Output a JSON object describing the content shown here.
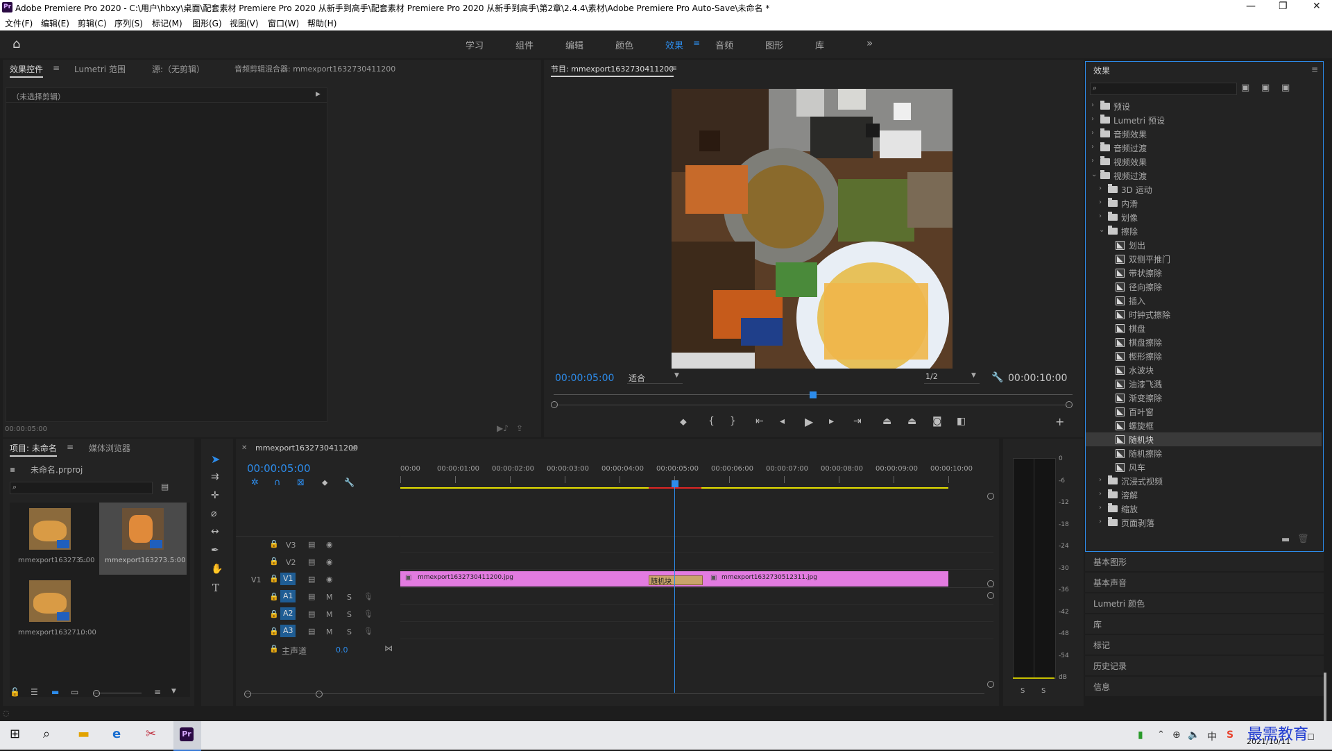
{
  "window": {
    "app_icon": "Pr",
    "title": "Adobe Premiere Pro 2020 - C:\\用户\\hbxy\\桌面\\配套素材 Premiere Pro 2020 从新手到高手\\配套素材 Premiere Pro 2020 从新手到高手\\第2章\\2.4.4\\素材\\Adobe Premiere Pro Auto-Save\\未命名 *"
  },
  "menu": [
    "文件(F)",
    "编辑(E)",
    "剪辑(C)",
    "序列(S)",
    "标记(M)",
    "图形(G)",
    "视图(V)",
    "窗口(W)",
    "帮助(H)"
  ],
  "workspaces": [
    "学习",
    "组件",
    "编辑",
    "颜色",
    "效果",
    "音频",
    "图形",
    "库"
  ],
  "active_workspace": "效果",
  "source_panel": {
    "tabs": [
      "效果控件",
      "Lumetri 范围",
      "源:（无剪辑）",
      "音频剪辑混合器: mmexport1632730411200"
    ],
    "no_clip": "（未选择剪辑）",
    "timecode": "00:00:05:00"
  },
  "program": {
    "tab": "节目: mmexport1632730411200",
    "timecode": "00:00:05:00",
    "fit": "适合",
    "resolution": "1/2",
    "duration": "00:00:10:00",
    "playhead_fraction": 0.5
  },
  "effects_panel": {
    "title": "效果",
    "tree": [
      {
        "label": "预设",
        "type": "preset",
        "depth": 0,
        "open": false
      },
      {
        "label": "Lumetri 预设",
        "type": "preset",
        "depth": 0,
        "open": false
      },
      {
        "label": "音频效果",
        "type": "folder",
        "depth": 0,
        "open": false
      },
      {
        "label": "音频过渡",
        "type": "folder",
        "depth": 0,
        "open": false
      },
      {
        "label": "视频效果",
        "type": "folder",
        "depth": 0,
        "open": false
      },
      {
        "label": "视频过渡",
        "type": "folder",
        "depth": 0,
        "open": true
      },
      {
        "label": "3D 运动",
        "type": "folder",
        "depth": 1,
        "open": false
      },
      {
        "label": "内滑",
        "type": "folder",
        "depth": 1,
        "open": false
      },
      {
        "label": "划像",
        "type": "folder",
        "depth": 1,
        "open": false
      },
      {
        "label": "擦除",
        "type": "folder",
        "depth": 1,
        "open": true
      },
      {
        "label": "划出",
        "type": "fx",
        "depth": 2
      },
      {
        "label": "双侧平推门",
        "type": "fx",
        "depth": 2
      },
      {
        "label": "带状擦除",
        "type": "fx",
        "depth": 2
      },
      {
        "label": "径向擦除",
        "type": "fx",
        "depth": 2
      },
      {
        "label": "插入",
        "type": "fx",
        "depth": 2
      },
      {
        "label": "时钟式擦除",
        "type": "fx",
        "depth": 2
      },
      {
        "label": "棋盘",
        "type": "fx",
        "depth": 2
      },
      {
        "label": "棋盘擦除",
        "type": "fx",
        "depth": 2
      },
      {
        "label": "楔形擦除",
        "type": "fx",
        "depth": 2
      },
      {
        "label": "水波块",
        "type": "fx",
        "depth": 2
      },
      {
        "label": "油漆飞溅",
        "type": "fx",
        "depth": 2
      },
      {
        "label": "渐变擦除",
        "type": "fx",
        "depth": 2
      },
      {
        "label": "百叶窗",
        "type": "fx",
        "depth": 2
      },
      {
        "label": "螺旋框",
        "type": "fx",
        "depth": 2
      },
      {
        "label": "随机块",
        "type": "fx",
        "depth": 2,
        "selected": true
      },
      {
        "label": "随机擦除",
        "type": "fx",
        "depth": 2
      },
      {
        "label": "风车",
        "type": "fx",
        "depth": 2
      },
      {
        "label": "沉浸式视频",
        "type": "folder",
        "depth": 1,
        "open": false
      },
      {
        "label": "溶解",
        "type": "folder",
        "depth": 1,
        "open": false
      },
      {
        "label": "缩放",
        "type": "folder",
        "depth": 1,
        "open": false
      },
      {
        "label": "页面剥落",
        "type": "folder",
        "depth": 1,
        "open": false
      }
    ]
  },
  "side_panels": [
    "基本图形",
    "基本声音",
    "Lumetri 颜色",
    "库",
    "标记",
    "历史记录",
    "信息"
  ],
  "project": {
    "tabs": [
      "项目: 未命名",
      "媒体浏览器"
    ],
    "file": "未命名.prproj",
    "items": [
      {
        "name": "mmexport163273...",
        "duration": "5:00",
        "selected": false
      },
      {
        "name": "mmexport163273...",
        "duration": "5:00",
        "selected": true
      },
      {
        "name": "mmexport16327...",
        "duration": "10:00",
        "selected": false
      }
    ]
  },
  "timeline": {
    "tab": "mmexport1632730411200",
    "timecode": "00:00:05:00",
    "ruler": [
      "00:00",
      "00:00:01:00",
      "00:00:02:00",
      "00:00:03:00",
      "00:00:04:00",
      "00:00:05:00",
      "00:00:06:00",
      "00:00:07:00",
      "00:00:08:00",
      "00:00:09:00",
      "00:00:10:00"
    ],
    "video_tracks": [
      "V3",
      "V2",
      "V1"
    ],
    "audio_tracks": [
      "A1",
      "A2",
      "A3"
    ],
    "master_label": "主声道",
    "master_value": "0.0",
    "source_patch_v": "V1",
    "mute_label": "M",
    "solo_label": "S",
    "clip1": "mmexport1632730411200.jpg",
    "clip2": "mmexport1632730512311.jpg",
    "transition": "随机块",
    "playhead_seconds": 5,
    "total_seconds": 10
  },
  "meter": {
    "scale": [
      "0",
      "-6",
      "-12",
      "-18",
      "-24",
      "-30",
      "-36",
      "-42",
      "-48",
      "-54",
      "dB"
    ],
    "solo": [
      "S",
      "S"
    ]
  },
  "taskbar": {
    "ime": "中",
    "date": "2021/10/11",
    "watermark": "最需教育"
  },
  "colors": {
    "accent": "#2d8ceb",
    "clip": "#e27be0",
    "panel": "#232323",
    "background": "#1d1d1d"
  }
}
